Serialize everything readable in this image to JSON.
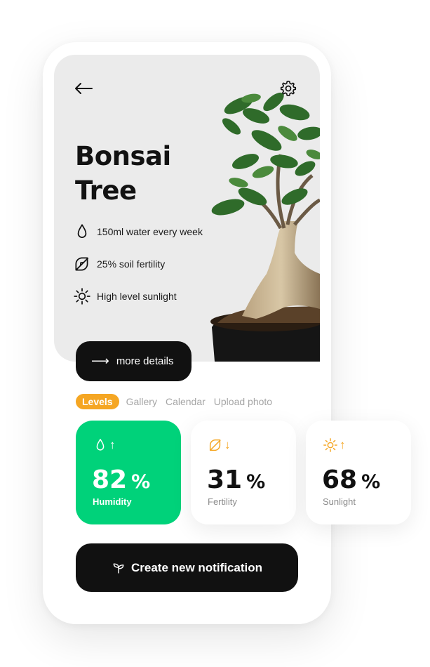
{
  "plant": {
    "title_line1": "Bonsai",
    "title_line2": "Tree",
    "features": [
      {
        "icon": "water-drop-icon",
        "text": "150ml water every week"
      },
      {
        "icon": "leaf-icon",
        "text": "25% soil fertility"
      },
      {
        "icon": "sun-icon",
        "text": "High level sunlight"
      }
    ]
  },
  "more_details": {
    "arrow": "⟶",
    "label": "more details"
  },
  "tabs": [
    "Levels",
    "Gallery",
    "Calendar",
    "Upload photo"
  ],
  "active_tab": "Levels",
  "stats": [
    {
      "name": "humidity",
      "icon": "water-drop-icon",
      "direction": "↑",
      "value": "82",
      "unit": "%",
      "label": "Humidity",
      "color": "#00d27a"
    },
    {
      "name": "fertility",
      "icon": "leaf-icon",
      "direction": "↓",
      "value": "31",
      "unit": "%",
      "label": "Fertility",
      "color": "#f5a623"
    },
    {
      "name": "sunlight",
      "icon": "sun-icon",
      "direction": "↑",
      "value": "68",
      "unit": "%",
      "label": "Sunlight",
      "color": "#f5a623"
    }
  ],
  "create_button": {
    "icon": "sprout-icon",
    "label": "Create new notification"
  },
  "colors": {
    "accent_green": "#00d27a",
    "accent_orange": "#f5a623",
    "dark": "#111111",
    "hero_bg": "#ebebeb"
  }
}
